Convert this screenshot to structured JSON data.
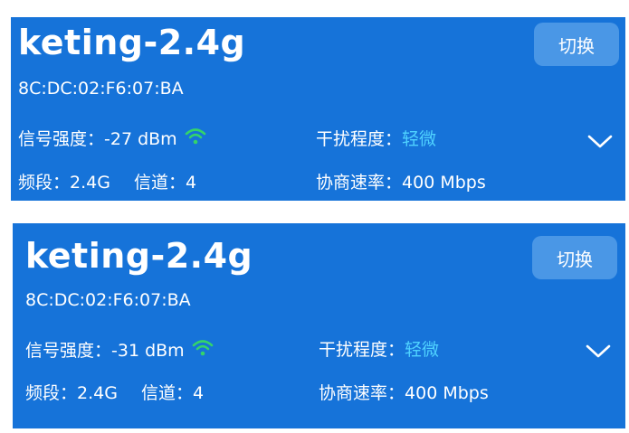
{
  "colors": {
    "card_bg": "#1673d9",
    "button_bg": "#4a97e6",
    "wifi_icon": "#34d46a",
    "level_text": "#4fd2ff"
  },
  "networks": [
    {
      "ssid": "keting-2.4g",
      "mac": "8C:DC:02:F6:07:BA",
      "signal_label": "信号强度：",
      "signal_value": "-27 dBm",
      "interference_label": "干扰程度：",
      "interference_value": "轻微",
      "band_label": "频段：",
      "band_value": "2.4G",
      "channel_label": "信道：",
      "channel_value": "4",
      "rate_label": "协商速率：",
      "rate_value": "400 Mbps",
      "switch_label": "切换",
      "icons": [
        "wifi-icon",
        "chevron-down-icon"
      ]
    },
    {
      "ssid": "keting-2.4g",
      "mac": "8C:DC:02:F6:07:BA",
      "signal_label": "信号强度：",
      "signal_value": "-31 dBm",
      "interference_label": "干扰程度：",
      "interference_value": "轻微",
      "band_label": "频段：",
      "band_value": "2.4G",
      "channel_label": "信道：",
      "channel_value": "4",
      "rate_label": "协商速率：",
      "rate_value": "400 Mbps",
      "switch_label": "切换",
      "icons": [
        "wifi-icon",
        "chevron-down-icon"
      ]
    }
  ]
}
